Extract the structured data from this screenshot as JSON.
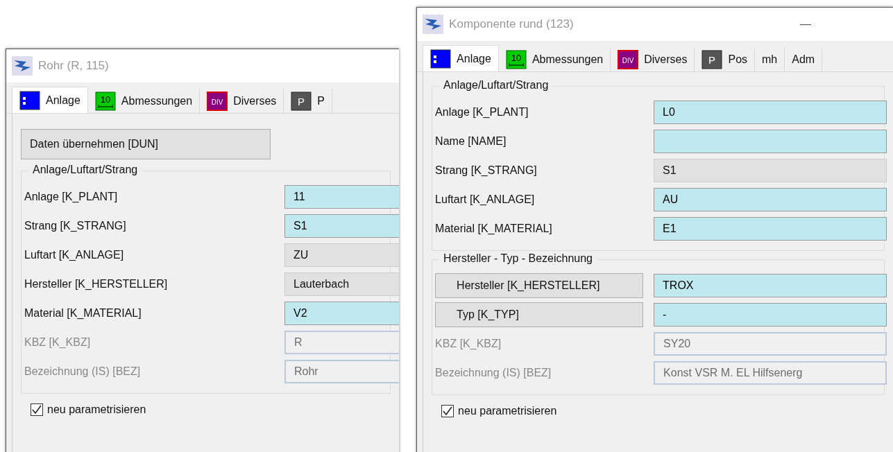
{
  "windows": [
    {
      "title": "Rohr (R, 115)",
      "tabs": [
        {
          "label": "Anlage",
          "selected": true
        },
        {
          "label": "Abmessungen",
          "icon_text": "10",
          "selected": false
        },
        {
          "label": "Diverses",
          "icon_text": "DIV",
          "selected": false
        },
        {
          "label": "P",
          "icon_text": "P",
          "selected": false
        }
      ],
      "action_button": "Daten übernehmen [DUN]",
      "groups": [
        {
          "title": "Anlage/Luftart/Strang",
          "rows": [
            {
              "label": "Anlage [K_PLANT]",
              "label_button": false,
              "value": "11",
              "kind": "editable"
            },
            {
              "label": "Strang [K_STRANG]",
              "label_button": false,
              "value": "S1",
              "kind": "editable"
            },
            {
              "label": "Luftart [K_ANLAGE]",
              "label_button": false,
              "value": "ZU",
              "kind": "readonly"
            },
            {
              "label": "Hersteller [K_HERSTELLER]",
              "label_button": false,
              "value": "Lauterbach",
              "kind": "readonly"
            },
            {
              "label": "Material [K_MATERIAL]",
              "label_button": false,
              "value": "V2",
              "kind": "editable"
            },
            {
              "label": "KBZ [K_KBZ]",
              "label_button": false,
              "value": "R",
              "kind": "disabled"
            },
            {
              "label": "Bezeichnung (IS) [BEZ]",
              "label_button": false,
              "value": "Rohr",
              "kind": "disabled"
            }
          ]
        }
      ],
      "checkbox": {
        "label": "neu parametrisieren",
        "checked": true
      }
    },
    {
      "title": "Komponente rund (123)",
      "minimize": "—",
      "tabs": [
        {
          "label": "Anlage",
          "selected": true
        },
        {
          "label": "Abmessungen",
          "icon_text": "10",
          "selected": false
        },
        {
          "label": "Diverses",
          "icon_text": "DIV",
          "selected": false
        },
        {
          "label": "Pos",
          "icon_text": "P",
          "selected": false
        },
        {
          "label": "mh",
          "selected": false
        },
        {
          "label": "Adm",
          "selected": false
        }
      ],
      "groups": [
        {
          "title": "Anlage/Luftart/Strang",
          "rows": [
            {
              "label": "Anlage [K_PLANT]",
              "label_button": false,
              "value": "L0",
              "kind": "editable"
            },
            {
              "label": "Name [NAME]",
              "label_button": false,
              "kind": "editable"
            },
            {
              "label": "Strang [K_STRANG]",
              "label_button": false,
              "value": "S1",
              "kind": "readonly"
            },
            {
              "label": "Luftart [K_ANLAGE]",
              "label_button": false,
              "value": "AU",
              "kind": "editable"
            },
            {
              "label": "Material [K_MATERIAL]",
              "label_button": false,
              "value": "E1",
              "kind": "editable"
            }
          ]
        },
        {
          "title": "Hersteller - Typ - Bezeichnung",
          "rows": [
            {
              "label": "Hersteller [K_HERSTELLER]",
              "label_button": true,
              "value": "TROX",
              "kind": "editable"
            },
            {
              "label": "Typ [K_TYP]",
              "label_button": true,
              "value": "-",
              "kind": "editable"
            },
            {
              "label": "KBZ [K_KBZ]",
              "label_button": false,
              "value": "SY20",
              "kind": "disabled"
            },
            {
              "label": "Bezeichnung (IS) [BEZ]",
              "label_button": false,
              "value": "Konst VSR M. EL Hilfsenerg",
              "kind": "disabled"
            }
          ]
        }
      ],
      "checkbox": {
        "label": "neu parametrisieren",
        "checked": true
      }
    }
  ]
}
